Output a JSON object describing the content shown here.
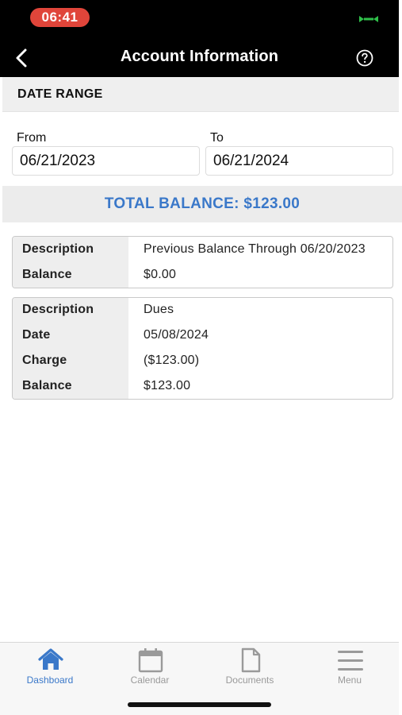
{
  "status_bar": {
    "time": "06:41",
    "status_icon": "screen-mirroring-icon",
    "accent": "#e0453a"
  },
  "header": {
    "title": "Account Information",
    "back_icon": "chevron-left-icon",
    "help_icon": "help-circle-icon"
  },
  "date_range": {
    "section_title": "DATE RANGE",
    "from_label": "From",
    "from_value": "06/21/2023",
    "to_label": "To",
    "to_value": "06/21/2024"
  },
  "total_balance": {
    "text": "TOTAL BALANCE: $123.00",
    "color": "#3a78c9"
  },
  "transactions": [
    {
      "rows": [
        {
          "label": "Description",
          "value": "Previous Balance Through 06/20/2023"
        },
        {
          "label": "Balance",
          "value": "$0.00"
        }
      ]
    },
    {
      "rows": [
        {
          "label": "Description",
          "value": "Dues"
        },
        {
          "label": "Date",
          "value": "05/08/2024"
        },
        {
          "label": "Charge",
          "value": "($123.00)"
        },
        {
          "label": "Balance",
          "value": "$123.00"
        }
      ]
    }
  ],
  "tab_bar": {
    "tabs": [
      {
        "label": "Dashboard",
        "icon": "home-icon",
        "active": true
      },
      {
        "label": "Calendar",
        "icon": "calendar-icon",
        "active": false
      },
      {
        "label": "Documents",
        "icon": "document-icon",
        "active": false
      },
      {
        "label": "Menu",
        "icon": "menu-icon",
        "active": false
      }
    ]
  }
}
